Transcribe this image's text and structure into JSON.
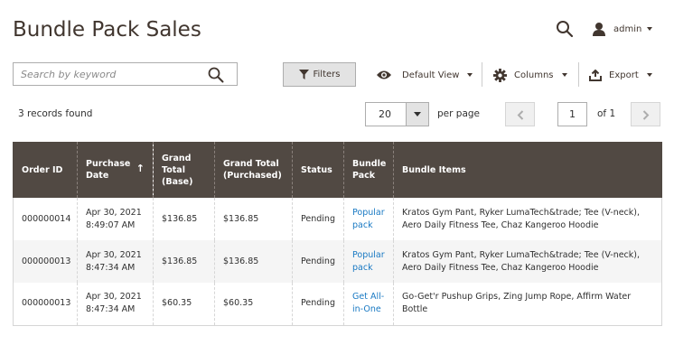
{
  "page": {
    "title": "Bundle Pack Sales"
  },
  "header": {
    "user": "admin"
  },
  "toolbar": {
    "search_placeholder": "Search by keyword",
    "filters_label": "Filters",
    "view_label": "Default View",
    "columns_label": "Columns",
    "export_label": "Export"
  },
  "summary": {
    "records_text": "3 records found"
  },
  "pagination": {
    "per_page_value": "20",
    "per_page_label": "per page",
    "current_page": "1",
    "of_text": "of 1"
  },
  "table": {
    "columns": [
      {
        "label": "Order ID"
      },
      {
        "label": "Purchase Date",
        "sort_indicator": "↑"
      },
      {
        "label": "Grand Total (Base)"
      },
      {
        "label": "Grand Total (Purchased)"
      },
      {
        "label": "Status"
      },
      {
        "label": "Bundle Pack"
      },
      {
        "label": "Bundle Items"
      }
    ],
    "rows": [
      {
        "order_id": "000000014",
        "purchase_date": "Apr 30, 2021 8:49:07 AM",
        "grand_total_base": "$136.85",
        "grand_total_purchased": "$136.85",
        "status": "Pending",
        "bundle_pack": "Popular pack",
        "bundle_items": "Kratos Gym Pant, Ryker LumaTech&trade; Tee (V-neck), Aero Daily Fitness Tee, Chaz Kangeroo Hoodie"
      },
      {
        "order_id": "000000013",
        "purchase_date": "Apr 30, 2021 8:47:34 AM",
        "grand_total_base": "$136.85",
        "grand_total_purchased": "$136.85",
        "status": "Pending",
        "bundle_pack": "Popular pack",
        "bundle_items": "Kratos Gym Pant, Ryker LumaTech&trade; Tee (V-neck), Aero Daily Fitness Tee, Chaz Kangeroo Hoodie"
      },
      {
        "order_id": "000000013",
        "purchase_date": "Apr 30, 2021 8:47:34 AM",
        "grand_total_base": "$60.35",
        "grand_total_purchased": "$60.35",
        "status": "Pending",
        "bundle_pack": "Get All-in-One",
        "bundle_items": "Go-Get'r Pushup Grips, Zing Jump Rope, Affirm Water Bottle"
      }
    ]
  },
  "colors": {
    "header_bg": "#514943",
    "link": "#1979c3",
    "title": "#41362f"
  }
}
